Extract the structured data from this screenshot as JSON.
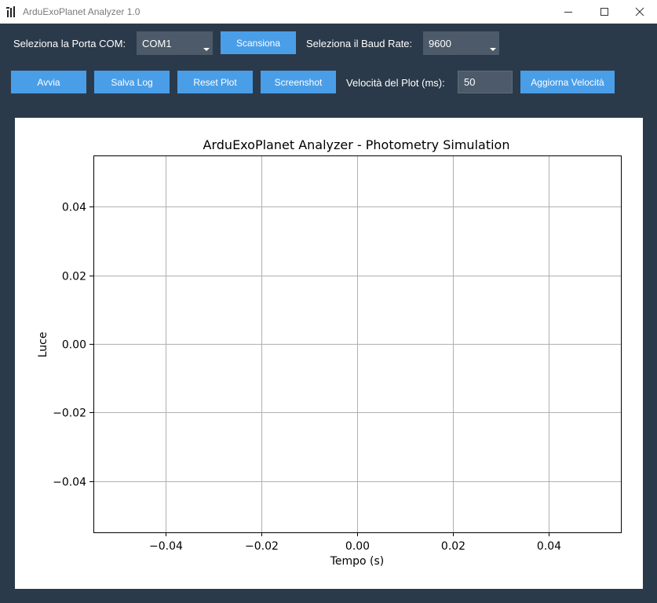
{
  "window": {
    "title": "ArduExoPlanet Analyzer 1.0",
    "controls": [
      "minimize",
      "maximize",
      "close"
    ]
  },
  "row1": {
    "com_label": "Seleziona la Porta COM:",
    "com_value": "COM1",
    "scan_label": "Scansiona",
    "baud_label": "Seleziona il Baud Rate:",
    "baud_value": "9600"
  },
  "row2": {
    "start_label": "Avvia",
    "save_log_label": "Salva Log",
    "reset_plot_label": "Reset Plot",
    "screenshot_label": "Screenshot",
    "speed_label": "Velocità del Plot (ms):",
    "speed_value": "50",
    "update_speed_label": "Aggiorna Velocità"
  },
  "colors": {
    "background": "#2b3a4a",
    "button": "#4a9ee8",
    "input": "#4c5a69",
    "grid": "#b0b0b0"
  },
  "chart_data": {
    "type": "line",
    "title": "ArduExoPlanet Analyzer - Photometry Simulation",
    "xlabel": "Tempo (s)",
    "ylabel": "Luce",
    "xlim": [
      -0.055,
      0.055
    ],
    "ylim": [
      -0.055,
      0.055
    ],
    "xticks": [
      -0.04,
      -0.02,
      0.0,
      0.02,
      0.04
    ],
    "xtick_labels": [
      "−0.04",
      "−0.02",
      "0.00",
      "0.02",
      "0.04"
    ],
    "yticks": [
      0.04,
      0.02,
      0.0,
      -0.02,
      -0.04
    ],
    "ytick_labels": [
      "0.04",
      "0.02",
      "0.00",
      "−0.02",
      "−0.04"
    ],
    "grid": true,
    "series": []
  }
}
